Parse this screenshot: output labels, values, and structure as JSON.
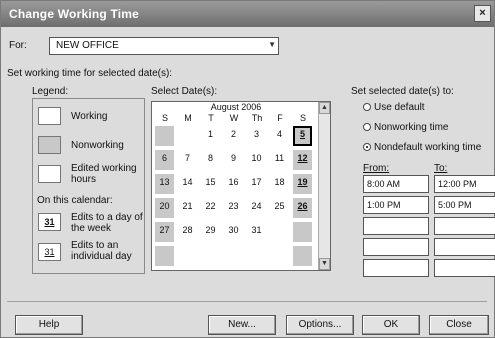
{
  "window": {
    "title": "Change Working Time",
    "close_label": "×"
  },
  "for_field": {
    "label": "For:",
    "value": "NEW OFFICE"
  },
  "set_working_label": "Set working time for selected date(s):",
  "legend": {
    "heading": "Legend:",
    "working": "Working",
    "nonworking": "Nonworking",
    "edited_line1": "Edited working",
    "edited_line2": "hours",
    "on_this_calendar": "On this calendar:",
    "edits_day_line1": "Edits to a day of",
    "edits_day_line2": "the week",
    "edits_individual_line1": "Edits to an",
    "edits_individual_line2": "individual day",
    "sample_31": "31",
    "sample_31b": "31"
  },
  "calendar": {
    "select_label": "Select Date(s):",
    "month": "August 2006",
    "days": [
      "S",
      "M",
      "T",
      "W",
      "Th",
      "F",
      "S"
    ],
    "weeks": [
      [
        "",
        "",
        "1",
        "2",
        "3",
        "4",
        "5"
      ],
      [
        "6",
        "7",
        "8",
        "9",
        "10",
        "11",
        "12"
      ],
      [
        "13",
        "14",
        "15",
        "16",
        "17",
        "18",
        "19"
      ],
      [
        "20",
        "21",
        "22",
        "23",
        "24",
        "25",
        "26"
      ],
      [
        "27",
        "28",
        "29",
        "30",
        "31",
        "",
        ""
      ],
      [
        "",
        "",
        "",
        "",
        "",
        "",
        ""
      ]
    ]
  },
  "set_selected": {
    "heading": "Set selected date(s) to:",
    "opt_default": "Use default",
    "opt_nonworking": "Nonworking time",
    "opt_nondefault": "Nondefault working time",
    "from_label": "From:",
    "to_label": "To:",
    "from_values": [
      "8:00 AM",
      "1:00 PM",
      "",
      "",
      ""
    ],
    "to_values": [
      "12:00 PM",
      "5:00 PM",
      "",
      "",
      ""
    ]
  },
  "buttons": {
    "help": "Help",
    "new": "New...",
    "options": "Options...",
    "ok": "OK",
    "close": "Close"
  }
}
